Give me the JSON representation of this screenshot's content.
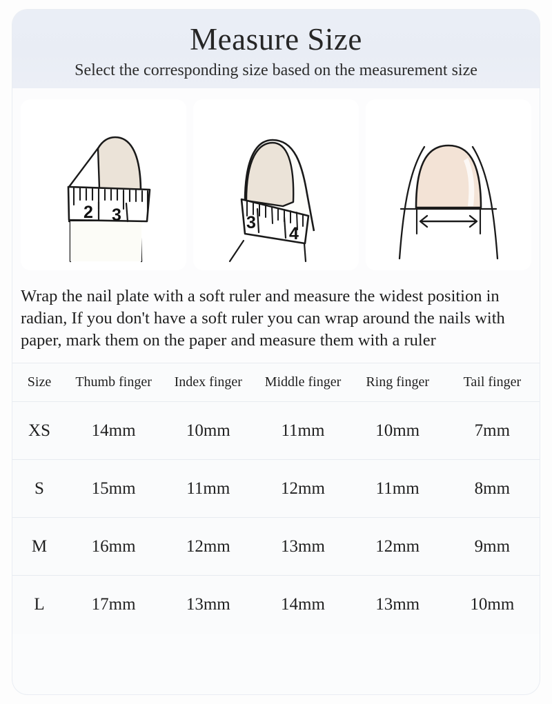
{
  "header": {
    "title": "Measure Size",
    "subtitle": "Select the corresponding size based on the measurement size"
  },
  "figures": [
    {
      "name": "finger-with-soft-ruler-2-3",
      "alt": "Finger with soft ruler wrapped around nail showing marks 2 and 3",
      "ruler_labels": [
        "2",
        "3"
      ]
    },
    {
      "name": "finger-with-soft-ruler-3-4",
      "alt": "Tilted finger with soft ruler wrapped around nail showing marks 3 and 4",
      "ruler_labels": [
        "3",
        "4"
      ]
    },
    {
      "name": "nail-width-arrow",
      "alt": "Nail with double-headed arrow indicating widest width measurement",
      "ruler_labels": []
    }
  ],
  "instructions": {
    "text": "Wrap the nail plate with a soft ruler and measure the widest position in radian, If you don't have a soft ruler you can wrap around the nails with paper, mark them on the paper and measure them with a ruler"
  },
  "table": {
    "headers": [
      "Size",
      "Thumb finger",
      "Index finger",
      "Middle finger",
      "Ring finger",
      "Tail finger"
    ],
    "rows": [
      {
        "size": "XS",
        "thumb": "14mm",
        "index": "10mm",
        "middle": "11mm",
        "ring": "10mm",
        "tail": "7mm"
      },
      {
        "size": "S",
        "thumb": "15mm",
        "index": "11mm",
        "middle": "12mm",
        "ring": "11mm",
        "tail": "8mm"
      },
      {
        "size": "M",
        "thumb": "16mm",
        "index": "12mm",
        "middle": "13mm",
        "ring": "12mm",
        "tail": "9mm"
      },
      {
        "size": "L",
        "thumb": "17mm",
        "index": "13mm",
        "middle": "14mm",
        "ring": "13mm",
        "tail": "10mm"
      }
    ]
  },
  "colors": {
    "header_band": "#eaeef6",
    "card_background": "#fbfcfd",
    "page_background": "#fdfdfd",
    "text": "#1f1f1f",
    "nail_beige": "#ebe3d8",
    "nail_pink": "#f3e3d6",
    "ink": "#1a1a1a",
    "divider": "#e7ebf0"
  }
}
